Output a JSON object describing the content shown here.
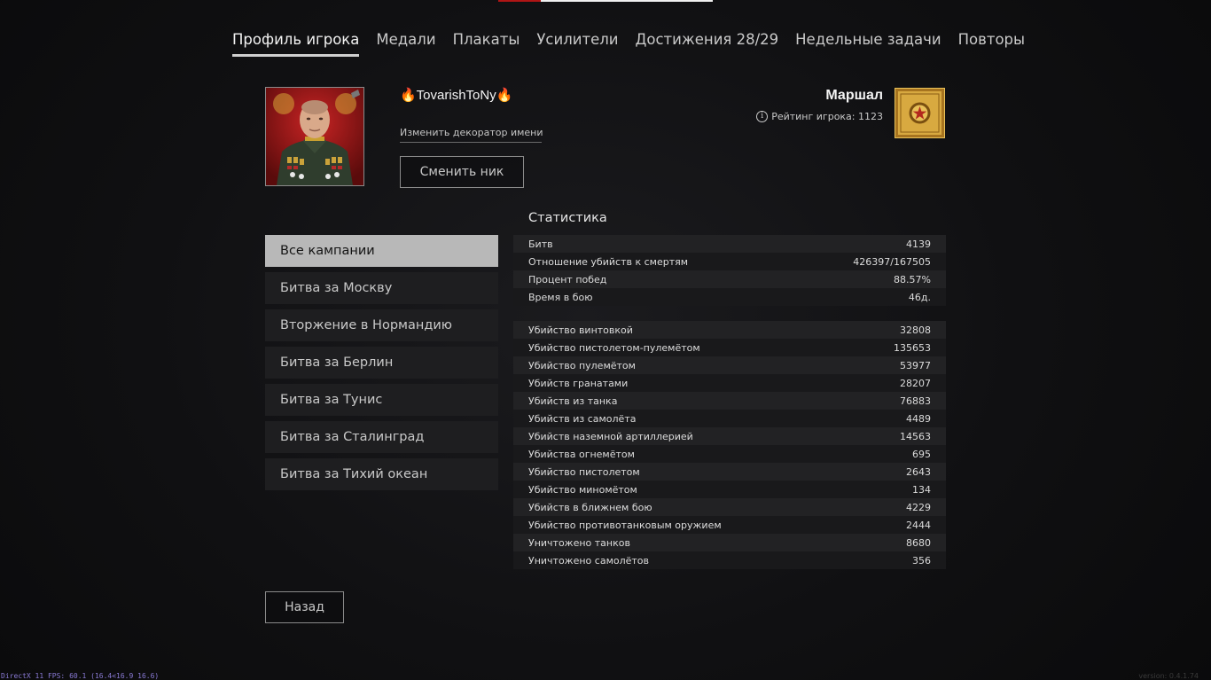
{
  "top_progress": {
    "value": 0.2
  },
  "tabs": [
    {
      "label": "Профиль игрока",
      "active": true
    },
    {
      "label": "Медали"
    },
    {
      "label": "Плакаты"
    },
    {
      "label": "Усилители"
    },
    {
      "label": "Достижения 28/29"
    },
    {
      "label": "Недельные задачи"
    },
    {
      "label": "Повторы"
    }
  ],
  "profile": {
    "nickname": "🔥TovarishToNy🔥",
    "decorator_link": "Изменить декоратор имени",
    "change_nick_label": "Сменить ник",
    "rank_name": "Маршал",
    "rating_label": "Рейтинг игрока: 1123"
  },
  "campaigns": [
    {
      "label": "Все кампании",
      "active": true
    },
    {
      "label": "Битва за Москву"
    },
    {
      "label": "Вторжение в Нормандию"
    },
    {
      "label": "Битва за Берлин"
    },
    {
      "label": "Битва за Тунис"
    },
    {
      "label": "Битва за Сталинград"
    },
    {
      "label": "Битва за Тихий океан"
    }
  ],
  "stats": {
    "title": "Статистика",
    "general": [
      {
        "label": "Битв",
        "value": "4139"
      },
      {
        "label": "Отношение убийств к смертям",
        "value": "426397/167505"
      },
      {
        "label": "Процент побед",
        "value": "88.57%"
      },
      {
        "label": "Время в бою",
        "value": "46д."
      }
    ],
    "kills": [
      {
        "label": "Убийство винтовкой",
        "value": "32808"
      },
      {
        "label": "Убийство пистолетом-пулемётом",
        "value": "135653"
      },
      {
        "label": "Убийство пулемётом",
        "value": "53977"
      },
      {
        "label": "Убийств гранатами",
        "value": "28207"
      },
      {
        "label": "Убийств из танка",
        "value": "76883"
      },
      {
        "label": "Убийств из самолёта",
        "value": "4489"
      },
      {
        "label": "Убийств наземной артиллерией",
        "value": "14563"
      },
      {
        "label": "Убийства огнемётом",
        "value": "695"
      },
      {
        "label": "Убийство пистолетом",
        "value": "2643"
      },
      {
        "label": "Убийство миномётом",
        "value": "134"
      },
      {
        "label": "Убийств в ближнем бою",
        "value": "4229"
      },
      {
        "label": "Убийство противотанковым оружием",
        "value": "2444"
      },
      {
        "label": "Уничтожено танков",
        "value": "8680"
      },
      {
        "label": "Уничтожено самолётов",
        "value": "356"
      }
    ]
  },
  "back_label": "Назад",
  "footer": {
    "fps": "DirectX 11 FPS: 60.1 (16.4<16.9 16.6)",
    "version": "version: 0.4.1.74"
  },
  "icons": {
    "edit": "pencil-icon",
    "info": "info-icon",
    "rank": "rank-badge-icon",
    "avatar": "player-avatar"
  },
  "colors": {
    "background": "#0b0b0d",
    "active_tab_underline": "#cfcfcf",
    "active_campaign": "#b8b8b8",
    "rank_badge_gold": "#d8a940",
    "progress_red": "#b01515"
  }
}
